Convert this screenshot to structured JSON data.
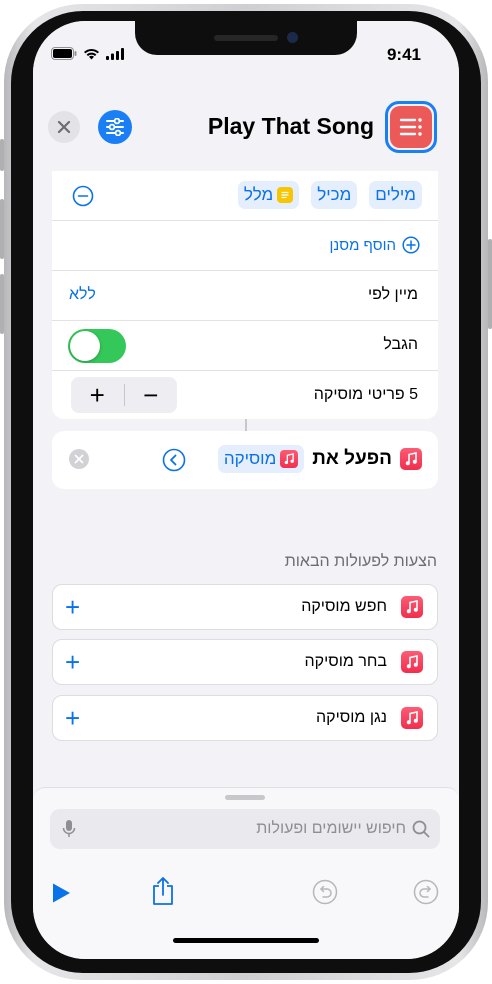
{
  "status_bar": {
    "time": "9:41"
  },
  "header": {
    "title": "Play That Song",
    "close_icon": "close-icon",
    "settings_icon": "sliders-icon",
    "app_icon": "list-icon",
    "app_icon_color": "#ec5959"
  },
  "filter_card": {
    "filter_row": {
      "field": "מילים",
      "operator": "מכיל",
      "value_token": "מלל"
    },
    "add_filter": "הוסף מסנן",
    "sort_row": {
      "label": "מיין לפי",
      "value": "ללא"
    },
    "limit_row": {
      "label": "הגבל",
      "toggle_on": true
    },
    "count_row": {
      "label": "5 פריטי מוסיקה",
      "minus": "−",
      "plus": "+"
    }
  },
  "play_action": {
    "label": "הפעל את",
    "token": "מוסיקה"
  },
  "suggestions": {
    "title": "הצעות לפעולות הבאות",
    "items": [
      {
        "label": "חפש מוסיקה"
      },
      {
        "label": "בחר מוסיקה"
      },
      {
        "label": "נגן מוסיקה"
      }
    ]
  },
  "bottom_sheet": {
    "search_placeholder": "חיפוש יישומים ופעולות"
  },
  "colors": {
    "accent": "#0a72e8",
    "toggle_on": "#34c759",
    "music": "#f22e4e"
  }
}
